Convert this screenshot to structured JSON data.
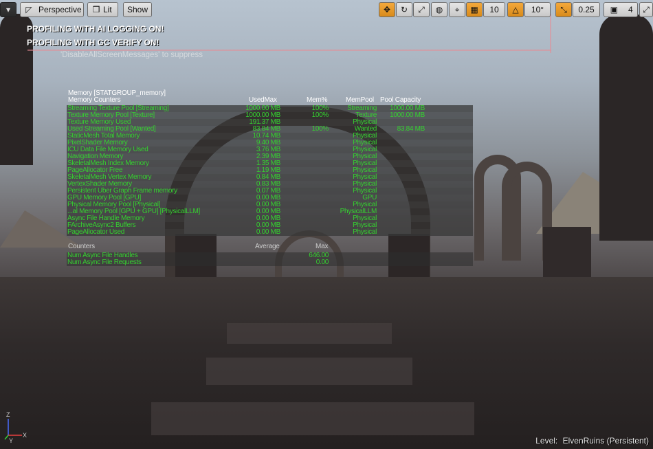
{
  "toolbar": {
    "left_menu_icon": "dropdown-arrow-icon",
    "perspective_label": "Perspective",
    "lit_label": "Lit",
    "show_label": "Show",
    "grid_value": "10",
    "angle_value": "10°",
    "scale_value": "0.25",
    "camera_speed_value": "4"
  },
  "messages": {
    "line1": "PROFILING WITH AI LOGGING ON!",
    "line2": "PROFILING WITH GC VERIFY ON!",
    "hint": "'DisableAllScreenMessages' to suppress"
  },
  "stats": {
    "group_title": "Memory [STATGROUP_memory]",
    "headers": {
      "name": "Memory Counters",
      "used": "UsedMax",
      "pct": "Mem%",
      "pool": "MemPool",
      "cap": "Pool Capacity"
    },
    "rows": [
      {
        "name": "Streaming Texture Pool [Streaming]",
        "used": "1000.00 MB",
        "pct": "100%",
        "pool": "Streaming",
        "cap": "1000.00 MB"
      },
      {
        "name": "Texture Memory Pool [Texture]",
        "used": "1000.00 MB",
        "pct": "100%",
        "pool": "Texture",
        "cap": "1000.00 MB"
      },
      {
        "name": "Texture Memory Used",
        "used": "191.37 MB",
        "pct": "",
        "pool": "Physical",
        "cap": ""
      },
      {
        "name": "Used Streaming Pool [Wanted]",
        "used": "83.84 MB",
        "pct": "100%",
        "pool": "Wanted",
        "cap": "83.84 MB"
      },
      {
        "name": "StaticMesh Total Memory",
        "used": "10.74 MB",
        "pct": "",
        "pool": "Physical",
        "cap": ""
      },
      {
        "name": "PixelShader Memory",
        "used": "9.40 MB",
        "pct": "",
        "pool": "Physical",
        "cap": ""
      },
      {
        "name": "ICU Data File Memory Used",
        "used": "3.76 MB",
        "pct": "",
        "pool": "Physical",
        "cap": ""
      },
      {
        "name": "Navigation Memory",
        "used": "2.39 MB",
        "pct": "",
        "pool": "Physical",
        "cap": ""
      },
      {
        "name": "SkeletalMesh Index Memory",
        "used": "1.35 MB",
        "pct": "",
        "pool": "Physical",
        "cap": ""
      },
      {
        "name": "PageAllocator Free",
        "used": "1.19 MB",
        "pct": "",
        "pool": "Physical",
        "cap": ""
      },
      {
        "name": "SkeletalMesh Vertex Memory",
        "used": "0.84 MB",
        "pct": "",
        "pool": "Physical",
        "cap": ""
      },
      {
        "name": "VertexShader Memory",
        "used": "0.83 MB",
        "pct": "",
        "pool": "Physical",
        "cap": ""
      },
      {
        "name": "Persistent Uber Graph Frame memory",
        "used": "0.07 MB",
        "pct": "",
        "pool": "Physical",
        "cap": ""
      },
      {
        "name": "GPU Memory Pool [GPU]",
        "used": "0.00 MB",
        "pct": "",
        "pool": "GPU",
        "cap": ""
      },
      {
        "name": "Physical Memory Pool [Physical]",
        "used": "0.00 MB",
        "pct": "",
        "pool": "Physical",
        "cap": ""
      },
      {
        "name": "...al Memory Pool [GPU + GPU] [PhysicalLLM]",
        "used": "0.00 MB",
        "pct": "",
        "pool": "PhysicalLLM",
        "cap": ""
      },
      {
        "name": "Async File Handle Memory",
        "used": "0.00 MB",
        "pct": "",
        "pool": "Physical",
        "cap": ""
      },
      {
        "name": "FArchiveAsync2 Buffers",
        "used": "0.00 MB",
        "pct": "",
        "pool": "Physical",
        "cap": ""
      },
      {
        "name": "PageAllocator Used",
        "used": "0.00 MB",
        "pct": "",
        "pool": "Physical",
        "cap": ""
      }
    ],
    "counters_headers": {
      "name": "Counters",
      "avg": "Average",
      "max": "Max"
    },
    "counter_rows": [
      {
        "name": "Num Async File Handles",
        "max": "646.00"
      },
      {
        "name": "Num Async File Requests",
        "max": "0.00"
      }
    ]
  },
  "footer": {
    "level_label": "Level:",
    "level_name": "ElvenRuins (Persistent)",
    "axis_z": "Z",
    "axis_x": "X",
    "axis_y": "Y"
  }
}
